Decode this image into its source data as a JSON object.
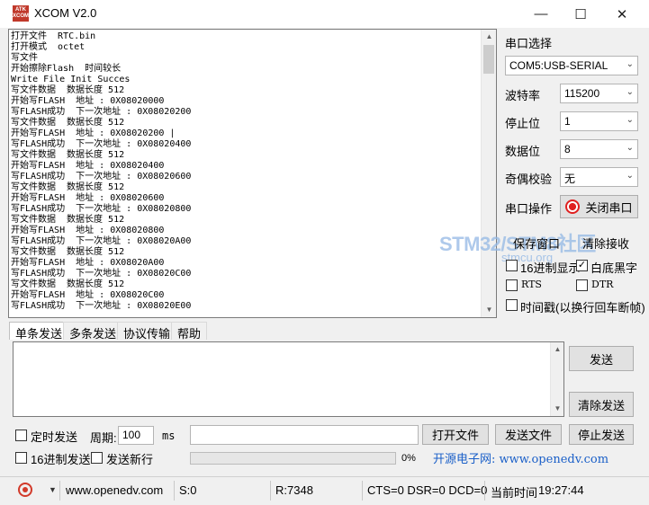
{
  "window": {
    "title": "XCOM V2.0",
    "logo_text": "ATK XCOM"
  },
  "receive": {
    "lines": [
      "打开文件  RTC.bin",
      "打开模式  octet",
      "写文件",
      "开始擦除Flash  时间较长",
      "Write File Init Succes",
      "写文件数据  数据长度 512",
      "开始写FLASH  地址 : 0X08020000",
      "写FLASH成功  下一次地址 : 0X08020200",
      "写文件数据  数据长度 512",
      "开始写FLASH  地址 : 0X08020200 |",
      "写FLASH成功  下一次地址 : 0X08020400",
      "写文件数据  数据长度 512",
      "开始写FLASH  地址 : 0X08020400",
      "写FLASH成功  下一次地址 : 0X08020600",
      "写文件数据  数据长度 512",
      "开始写FLASH  地址 : 0X08020600",
      "写FLASH成功  下一次地址 : 0X08020800",
      "写文件数据  数据长度 512",
      "开始写FLASH  地址 : 0X08020800",
      "写FLASH成功  下一次地址 : 0X08020A00",
      "写文件数据  数据长度 512",
      "开始写FLASH  地址 : 0X08020A00",
      "写FLASH成功  下一次地址 : 0X08020C00",
      "写文件数据  数据长度 512",
      "开始写FLASH  地址 : 0X08020C00",
      "写FLASH成功  下一次地址 : 0X08020E00"
    ]
  },
  "panel": {
    "port_select_label": "串口选择",
    "port_value": "COM5:USB-SERIAL",
    "baud_label": "波特率",
    "baud_value": "115200",
    "stopbits_label": "停止位",
    "stopbits_value": "1",
    "databits_label": "数据位",
    "databits_value": "8",
    "parity_label": "奇偶校验",
    "parity_value": "无",
    "port_op_label": "串口操作",
    "port_toggle_label": "关闭串口",
    "save_window_label": "保存窗口",
    "clear_receive_label": "清除接收",
    "hex_display_label": "16进制显示",
    "white_bg_label": "白底黑字",
    "rts_label": "RTS",
    "dtr_label": "DTR",
    "timestamp_label": "时间戳(以换行回车断帧)"
  },
  "watermark": {
    "main": "STM32/STM8社区",
    "sub": "stmcu.org"
  },
  "tabs": [
    "单条发送",
    "多条发送",
    "协议传输",
    "帮助"
  ],
  "send": {
    "send_label": "发送",
    "clear_send_label": "清除发送",
    "timed_send_label": "定时发送",
    "period_label": "周期:",
    "period_value": "100",
    "period_unit": "ms",
    "open_file_label": "打开文件",
    "send_file_label": "发送文件",
    "stop_send_label": "停止发送",
    "hex_send_label": "16进制发送",
    "newline_label": "发送新行",
    "progress_text": "0%",
    "progress": 0,
    "promo": "开源电子网: www.openedv.com"
  },
  "status": {
    "site": "www.openedv.com",
    "sent": "S:0",
    "received": "R:7348",
    "lines": "CTS=0 DSR=0 DCD=0",
    "time_label": "当前时间",
    "time_value": "19:27:44"
  },
  "colors": {
    "accent": "#c0392b",
    "watermark": "#93b8e5",
    "promo": "#1a5fc8"
  }
}
